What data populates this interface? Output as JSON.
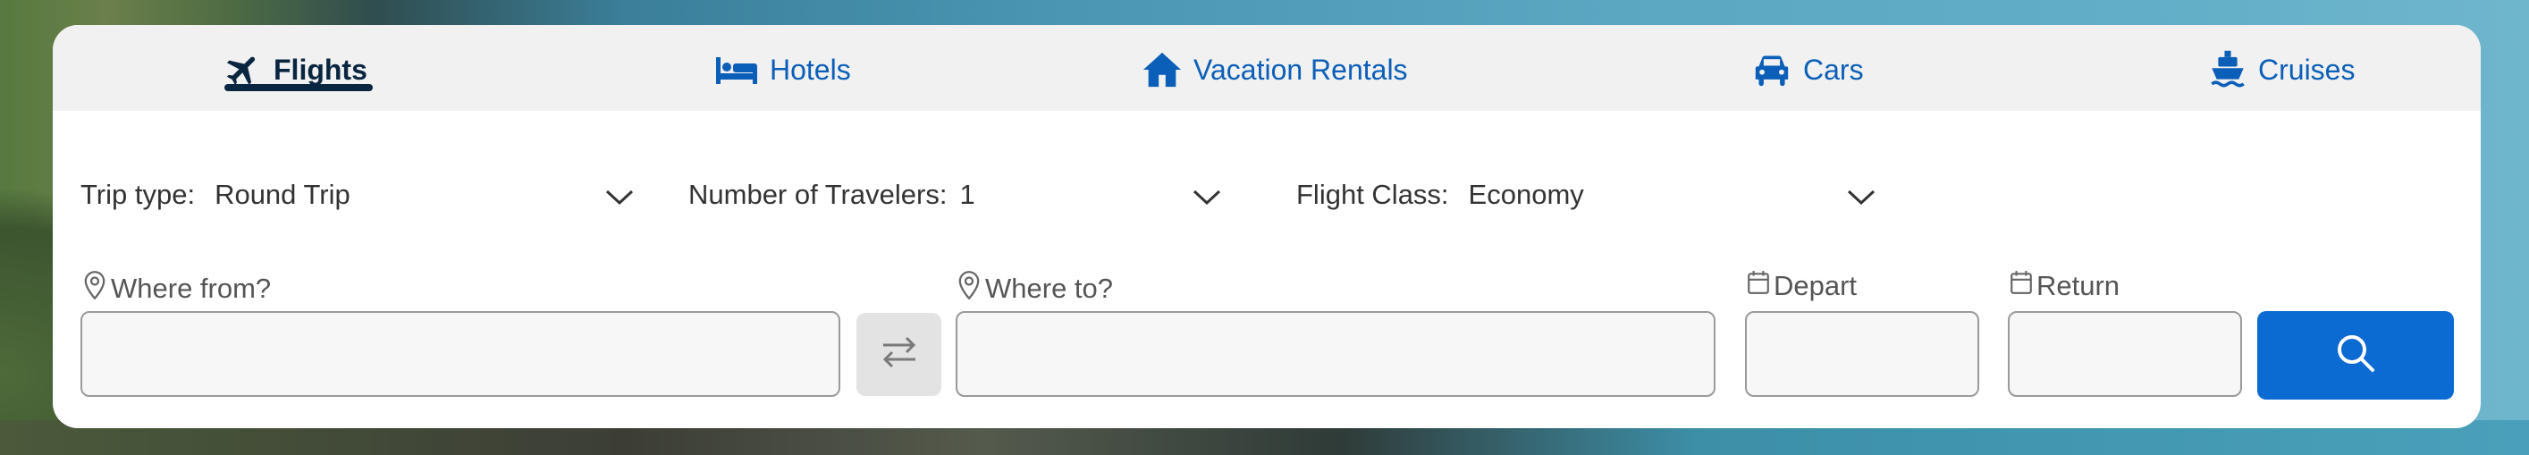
{
  "tabs": [
    {
      "label": "Flights",
      "icon": "plane-icon",
      "active": true
    },
    {
      "label": "Hotels",
      "icon": "bed-icon",
      "active": false
    },
    {
      "label": "Vacation Rentals",
      "icon": "house-icon",
      "active": false
    },
    {
      "label": "Cars",
      "icon": "car-icon",
      "active": false
    },
    {
      "label": "Cruises",
      "icon": "ship-icon",
      "active": false
    }
  ],
  "trip_type": {
    "label": "Trip type:",
    "value": "Round Trip"
  },
  "travelers": {
    "label": "Number of Travelers:",
    "value": "1"
  },
  "flight_class": {
    "label": "Flight Class:",
    "value": "Economy"
  },
  "where_from": {
    "label": "Where from?",
    "value": ""
  },
  "where_to": {
    "label": "Where to?",
    "value": ""
  },
  "depart": {
    "label": "Depart",
    "value": ""
  },
  "return": {
    "label": "Return",
    "value": ""
  },
  "colors": {
    "accent": "#0c6bd2",
    "tab_text": "#0b5fb8",
    "active_tab": "#0a2540"
  }
}
